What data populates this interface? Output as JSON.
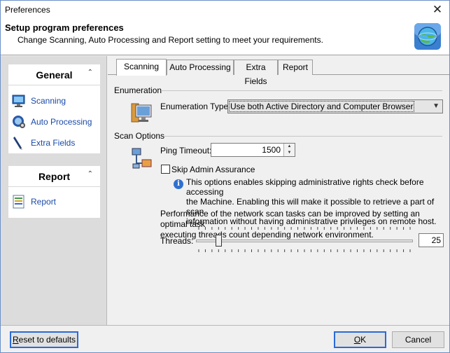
{
  "window": {
    "title": "Preferences",
    "close_glyph": "✕"
  },
  "header": {
    "title": "Setup program preferences",
    "subtitle": "Change Scanning, Auto Processing and Report setting to meet your requirements.",
    "icon": "globe-settings-icon"
  },
  "sidebar": {
    "groups": [
      {
        "title": "General",
        "chevron": "⌃",
        "items": [
          {
            "label": "Scanning",
            "icon": "monitor-scan-icon"
          },
          {
            "label": "Auto Processing",
            "icon": "auto-process-icon"
          },
          {
            "label": "Extra Fields",
            "icon": "pen-icon"
          }
        ]
      },
      {
        "title": "Report",
        "chevron": "⌃",
        "items": [
          {
            "label": "Report",
            "icon": "report-icon"
          }
        ]
      }
    ]
  },
  "tabs": [
    {
      "label": "Scanning",
      "active": true
    },
    {
      "label": "Auto Processing",
      "active": false
    },
    {
      "label": "Extra Fields",
      "active": false
    },
    {
      "label": "Report",
      "active": false
    }
  ],
  "enumeration": {
    "section_label": "Enumeration",
    "type_label": "Enumeration Type:",
    "type_value": "Use both Active Directory and Computer Browser"
  },
  "scan_options": {
    "section_label": "Scan Options",
    "ping_label": "Ping Timeout:",
    "ping_value": "1500",
    "skip_admin_label": "Skip Admin Assurance",
    "skip_admin_checked": false,
    "info_lines": [
      "This options enables skipping administrative rights check before accessing",
      "the Machine. Enabling this will make it possible to retrieve a part of scan",
      "information without having administrative privileges on remote host."
    ],
    "perf_lines": [
      "Performance of the network scan tasks can be improved by setting an optimal task",
      "executing threads count depending network environment."
    ],
    "threads_label": "Threads:",
    "threads_value": "25",
    "threads_min": 1,
    "threads_max": 255
  },
  "footer": {
    "reset_label_u": "R",
    "reset_label_rest": "eset to defaults",
    "ok_label_u": "O",
    "ok_label_rest": "K",
    "cancel_label": "Cancel"
  },
  "colors": {
    "link": "#1a4aa8",
    "focus": "#2a6ad8",
    "sidebar_bg": "#dcdcdc"
  }
}
